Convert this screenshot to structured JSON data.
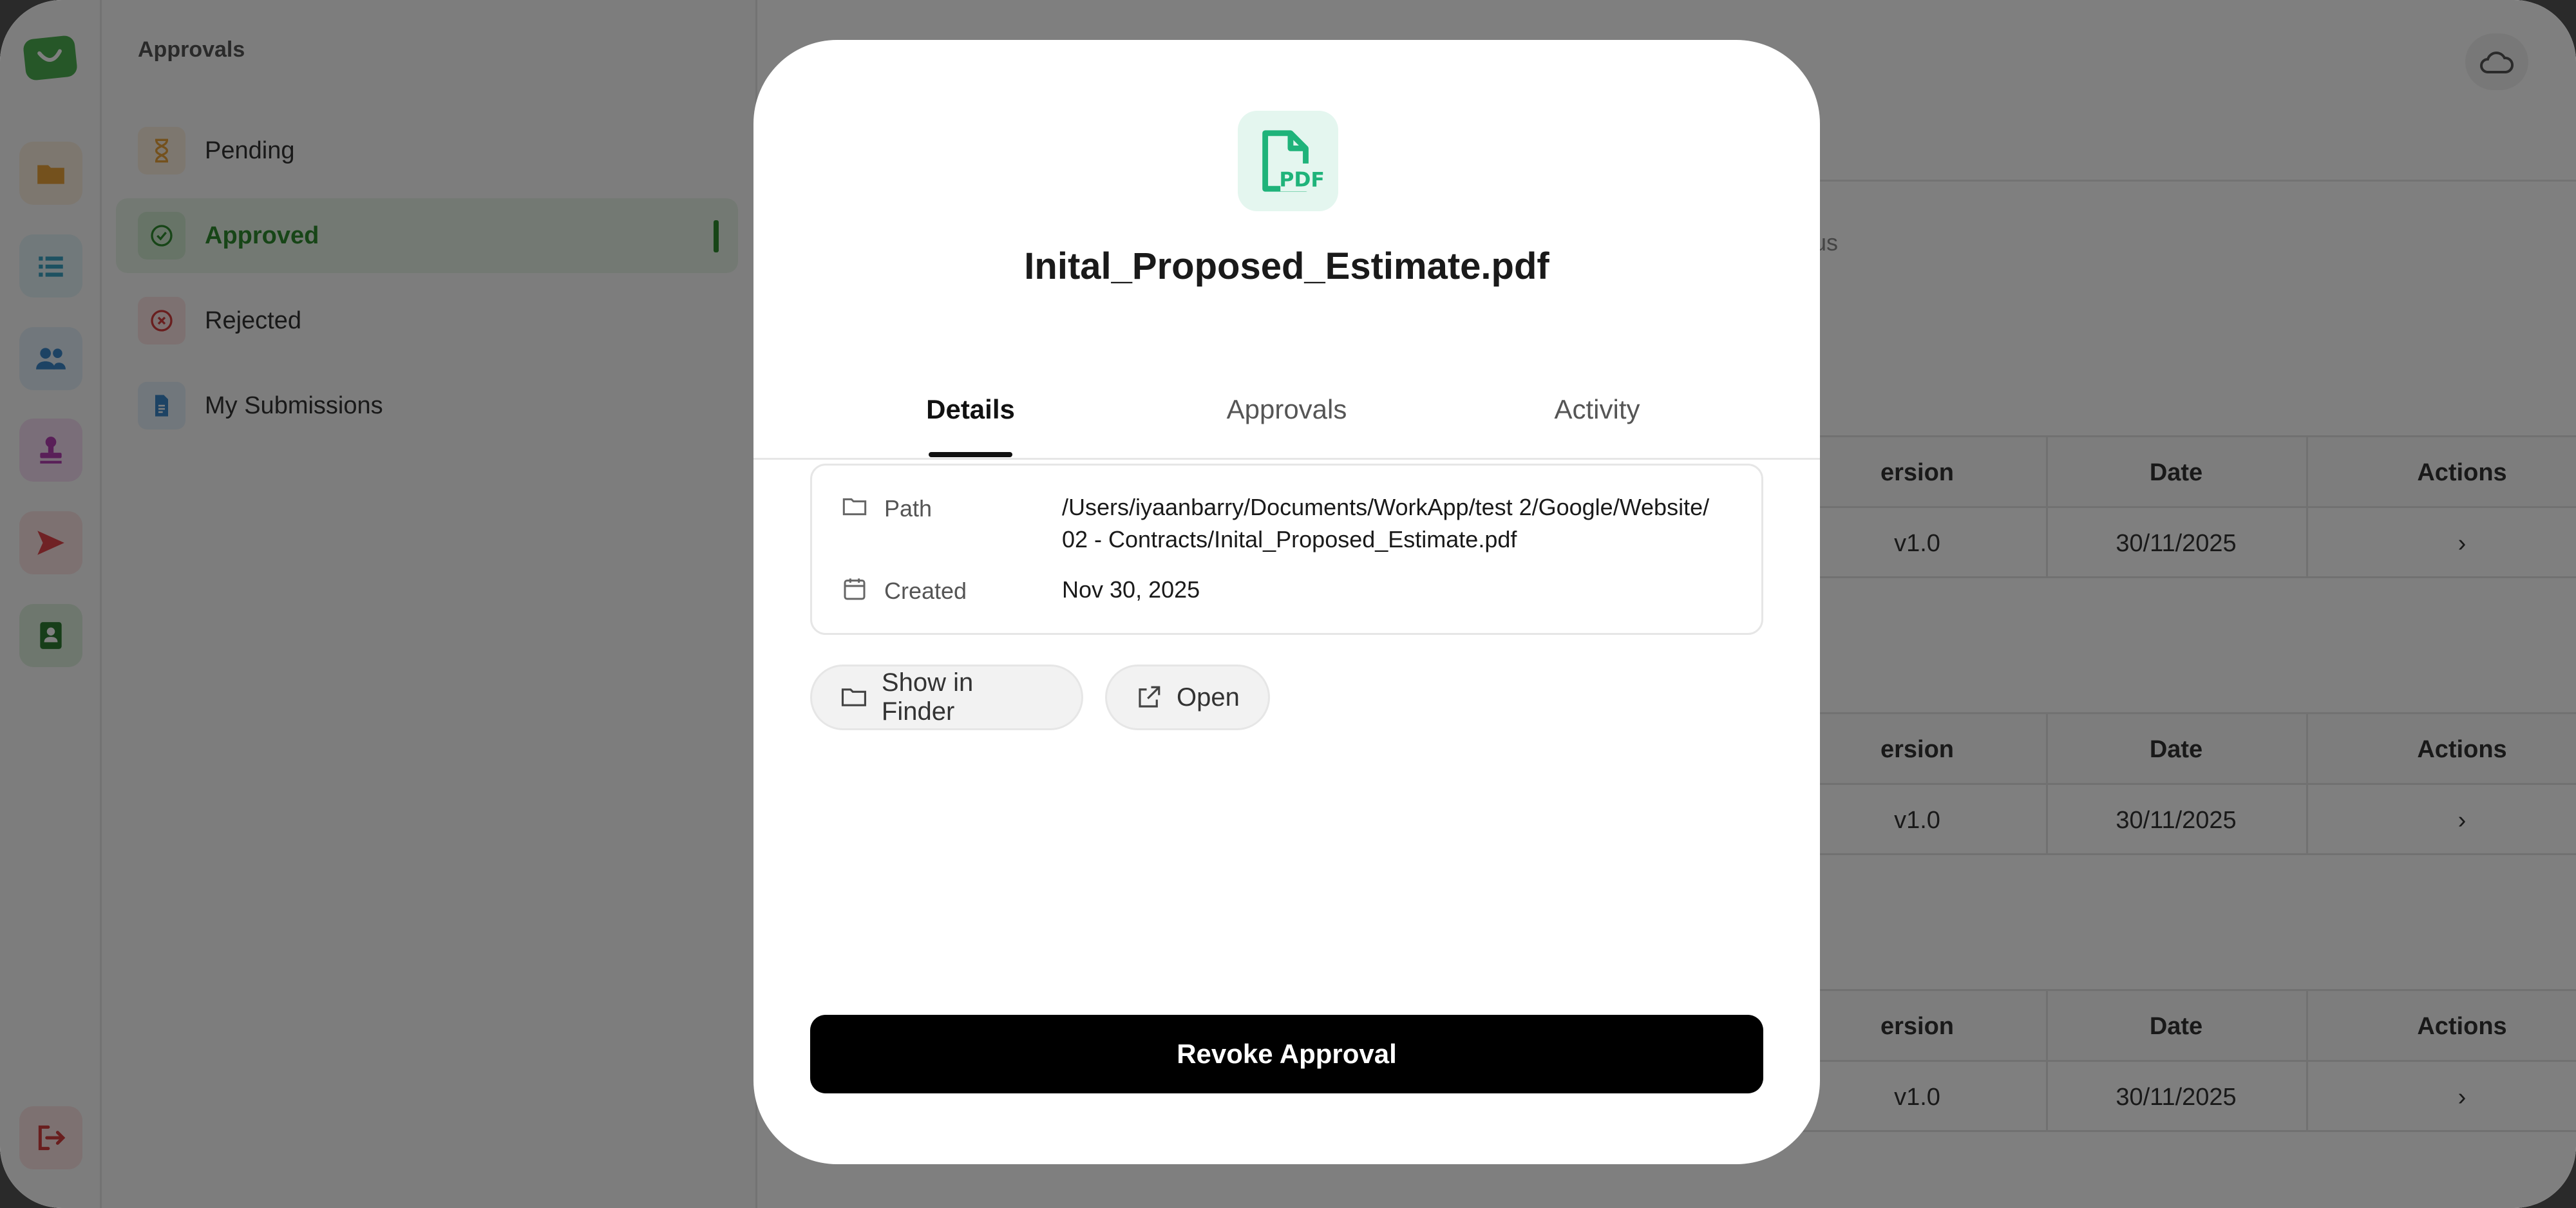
{
  "sidebar": {
    "title": "Approvals",
    "items": [
      {
        "label": "Pending",
        "icon": "hourglass-icon"
      },
      {
        "label": "Approved",
        "icon": "check-circle-icon"
      },
      {
        "label": "Rejected",
        "icon": "x-circle-icon"
      },
      {
        "label": "My Submissions",
        "icon": "document-icon"
      }
    ]
  },
  "main": {
    "status_header": "tus",
    "tables": [
      {
        "headers": [
          "ersion",
          "Date",
          "Actions"
        ],
        "row": [
          "v1.0",
          "30/11/2025",
          "›"
        ]
      },
      {
        "headers": [
          "ersion",
          "Date",
          "Actions"
        ],
        "row": [
          "v1.0",
          "30/11/2025",
          "›"
        ]
      },
      {
        "headers": [
          "ersion",
          "Date",
          "Actions"
        ],
        "row": [
          "v1.0",
          "30/11/2025",
          "›"
        ]
      }
    ]
  },
  "modal": {
    "file_name": "Inital_Proposed_Estimate.pdf",
    "badge_text": "PDF",
    "tabs": [
      "Details",
      "Approvals",
      "Activity"
    ],
    "path_label": "Path",
    "path_value_line1": "/Users/iyaanbarry/Documents/WorkApp/test 2/Google/Website/",
    "path_value_line2": "02 - Contracts/Inital_Proposed_Estimate.pdf",
    "created_label": "Created",
    "created_value": "Nov 30, 2025",
    "show_in_finder": "Show in Finder",
    "open": "Open",
    "revoke": "Revoke Approval"
  },
  "colors": {
    "accent_green": "#2e8b2e",
    "pdf_green": "#1fb37a",
    "revoke_bg": "#000000"
  }
}
